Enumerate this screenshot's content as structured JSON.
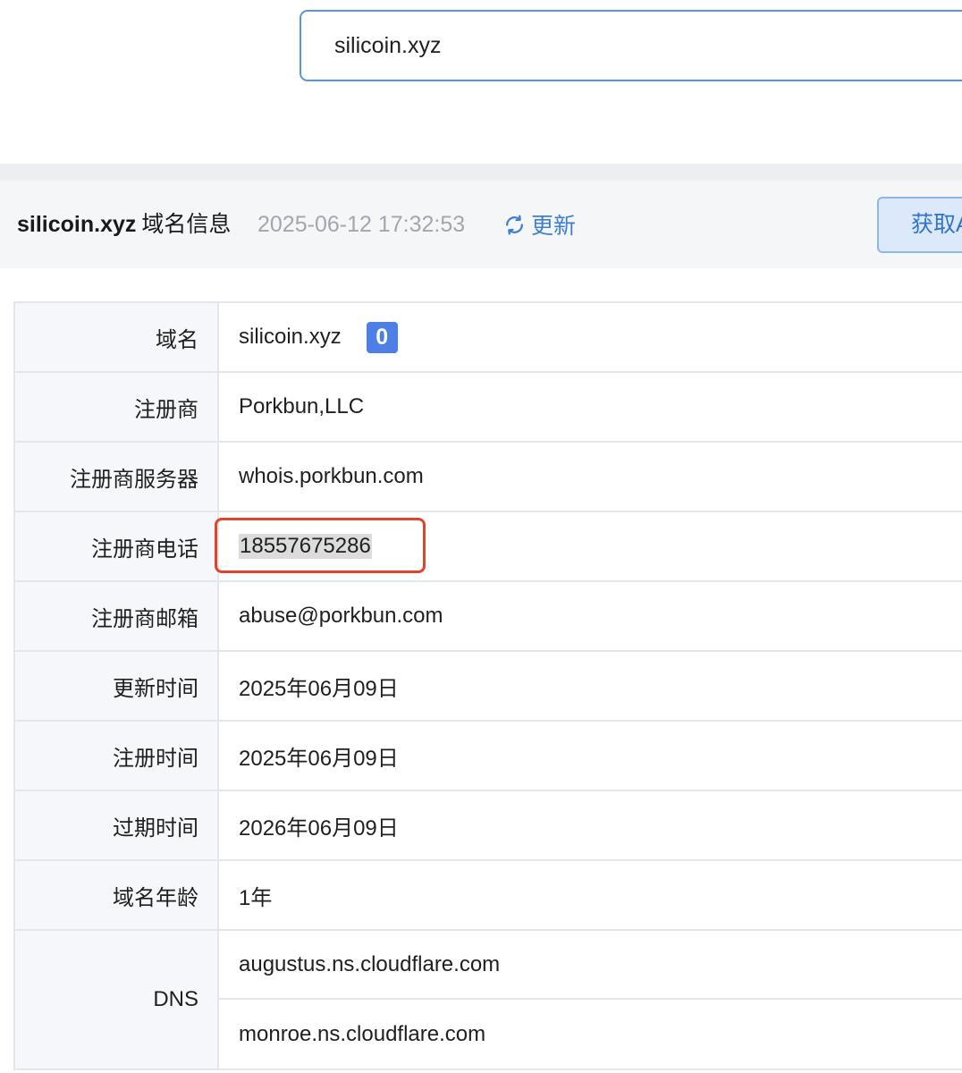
{
  "search": {
    "value": "silicoin.xyz"
  },
  "header": {
    "domain": "silicoin.xyz",
    "suffix": "域名信息",
    "timestamp": "2025-06-12 17:32:53",
    "refresh_label": "更新",
    "fetch_label": "获取A"
  },
  "details": {
    "domain": {
      "label": "域名",
      "value": "silicoin.xyz",
      "badge": "0"
    },
    "registrar": {
      "label": "注册商",
      "value": "Porkbun,LLC"
    },
    "registrar_server": {
      "label": "注册商服务器",
      "value": "whois.porkbun.com"
    },
    "registrar_phone": {
      "label": "注册商电话",
      "value": "18557675286"
    },
    "registrar_email": {
      "label": "注册商邮箱",
      "value": "abuse@porkbun.com"
    },
    "updated": {
      "label": "更新时间",
      "value": "2025年06月09日"
    },
    "registered": {
      "label": "注册时间",
      "value": "2025年06月09日"
    },
    "expires": {
      "label": "过期时间",
      "value": "2026年06月09日"
    },
    "age": {
      "label": "域名年龄",
      "value": "1年"
    },
    "dns": {
      "label": "DNS",
      "servers": [
        "augustus.ns.cloudflare.com",
        "monroe.ns.cloudflare.com"
      ]
    }
  },
  "colors": {
    "accent": "#3c7fd6",
    "badge": "#4d7fe6",
    "highlight": "#e0442e"
  },
  "icons": {
    "refresh": "refresh-icon"
  }
}
